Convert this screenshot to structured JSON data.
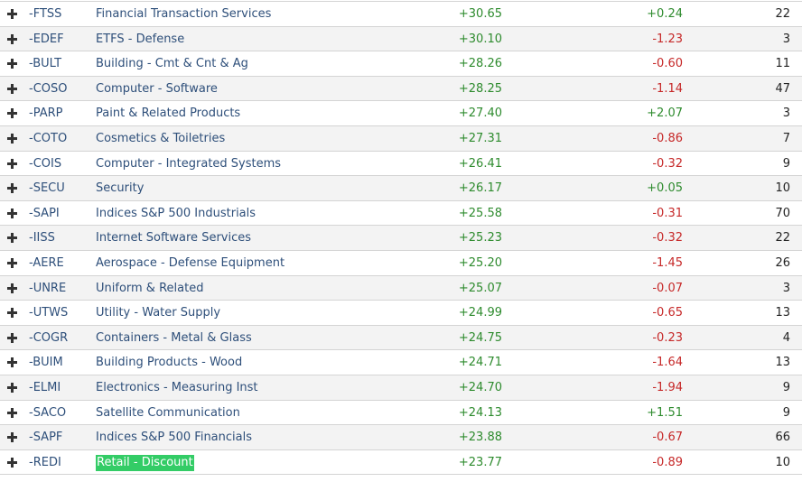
{
  "colors": {
    "positive": "#2e8b2e",
    "negative": "#c62828",
    "highlight": "#33cc66",
    "row_alt": "#f3f3f3"
  },
  "rows": [
    {
      "symbol": "-FTSS",
      "name": "Financial Transaction Services",
      "pct": "+30.65",
      "change": "+0.24",
      "count": "22"
    },
    {
      "symbol": "-EDEF",
      "name": "ETFS - Defense",
      "pct": "+30.10",
      "change": "-1.23",
      "count": "3"
    },
    {
      "symbol": "-BULT",
      "name": "Building - Cmt & Cnt & Ag",
      "pct": "+28.26",
      "change": "-0.60",
      "count": "11"
    },
    {
      "symbol": "-COSO",
      "name": "Computer - Software",
      "pct": "+28.25",
      "change": "-1.14",
      "count": "47"
    },
    {
      "symbol": "-PARP",
      "name": "Paint & Related Products",
      "pct": "+27.40",
      "change": "+2.07",
      "count": "3"
    },
    {
      "symbol": "-COTO",
      "name": "Cosmetics & Toiletries",
      "pct": "+27.31",
      "change": "-0.86",
      "count": "7"
    },
    {
      "symbol": "-COIS",
      "name": "Computer - Integrated Systems",
      "pct": "+26.41",
      "change": "-0.32",
      "count": "9"
    },
    {
      "symbol": "-SECU",
      "name": "Security",
      "pct": "+26.17",
      "change": "+0.05",
      "count": "10"
    },
    {
      "symbol": "-SAPI",
      "name": "Indices S&P 500 Industrials",
      "pct": "+25.58",
      "change": "-0.31",
      "count": "70"
    },
    {
      "symbol": "-IISS",
      "name": "Internet Software Services",
      "pct": "+25.23",
      "change": "-0.32",
      "count": "22"
    },
    {
      "symbol": "-AERE",
      "name": "Aerospace - Defense Equipment",
      "pct": "+25.20",
      "change": "-1.45",
      "count": "26"
    },
    {
      "symbol": "-UNRE",
      "name": "Uniform & Related",
      "pct": "+25.07",
      "change": "-0.07",
      "count": "3"
    },
    {
      "symbol": "-UTWS",
      "name": "Utility - Water Supply",
      "pct": "+24.99",
      "change": "-0.65",
      "count": "13"
    },
    {
      "symbol": "-COGR",
      "name": "Containers - Metal & Glass",
      "pct": "+24.75",
      "change": "-0.23",
      "count": "4"
    },
    {
      "symbol": "-BUIM",
      "name": "Building Products - Wood",
      "pct": "+24.71",
      "change": "-1.64",
      "count": "13"
    },
    {
      "symbol": "-ELMI",
      "name": "Electronics - Measuring Inst",
      "pct": "+24.70",
      "change": "-1.94",
      "count": "9"
    },
    {
      "symbol": "-SACO",
      "name": "Satellite Communication",
      "pct": "+24.13",
      "change": "+1.51",
      "count": "9"
    },
    {
      "symbol": "-SAPF",
      "name": "Indices S&P 500 Financials",
      "pct": "+23.88",
      "change": "-0.67",
      "count": "66"
    },
    {
      "symbol": "-REDI",
      "name": "Retail - Discount",
      "pct": "+23.77",
      "change": "-0.89",
      "count": "10",
      "highlighted": true
    }
  ]
}
